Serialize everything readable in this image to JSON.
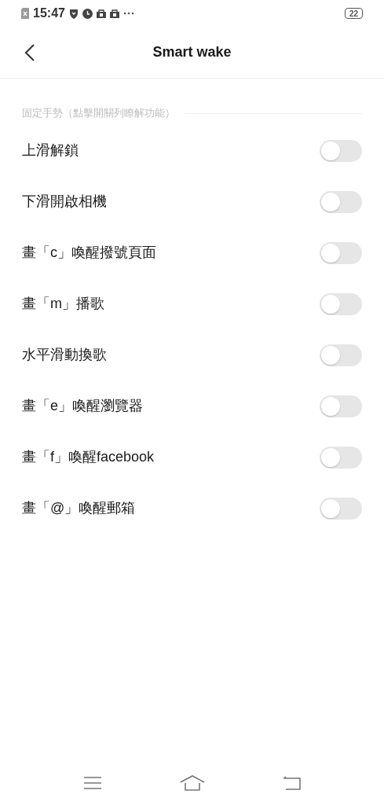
{
  "status_bar": {
    "time": "15:47",
    "battery": "22"
  },
  "header": {
    "title": "Smart wake"
  },
  "section": {
    "label": "固定手勢（點擊開關列瞭解功能）"
  },
  "settings": [
    {
      "label": "上滑解鎖",
      "on": false
    },
    {
      "label": "下滑開啟相機",
      "on": false
    },
    {
      "label": "畫「c」喚醒撥號頁面",
      "on": false
    },
    {
      "label": "畫「m」播歌",
      "on": false
    },
    {
      "label": "水平滑動換歌",
      "on": false
    },
    {
      "label": "畫「e」喚醒瀏覽器",
      "on": false
    },
    {
      "label": "畫「f」喚醒facebook",
      "on": false
    },
    {
      "label": "畫「@」喚醒郵箱",
      "on": false
    }
  ]
}
